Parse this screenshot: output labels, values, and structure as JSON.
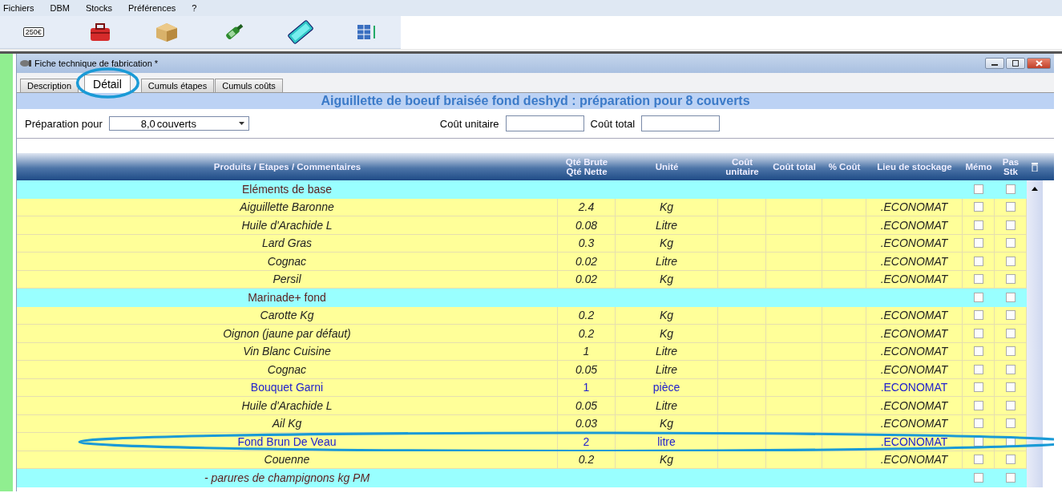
{
  "menu": [
    {
      "label": "Fichiers"
    },
    {
      "label": "DBM"
    },
    {
      "label": "Stocks"
    },
    {
      "label": "Préférences"
    },
    {
      "label": "?"
    }
  ],
  "toolbar": [
    {
      "kind": "tag",
      "label": "250€"
    },
    {
      "kind": "toolbox"
    },
    {
      "kind": "parcel"
    },
    {
      "kind": "bottle"
    },
    {
      "kind": "keyboard"
    },
    {
      "kind": "grid"
    }
  ],
  "window": {
    "title": "Fiche technique de fabrication *"
  },
  "tabs": [
    {
      "label": "Description",
      "selected": false
    },
    {
      "label": "Détail",
      "selected": true,
      "circled": true
    },
    {
      "label": "Cumuls étapes",
      "selected": false
    },
    {
      "label": "Cumuls coûts",
      "selected": false
    }
  ],
  "heading": "Aiguillette de boeuf braisée fond deshyd : préparation pour 8 couverts",
  "preparation": {
    "label": "Préparation pour",
    "value": "8,0",
    "unit": "couverts"
  },
  "unit_cost": {
    "label": "Coût unitaire"
  },
  "total_cost": {
    "label": "Coût total"
  },
  "table": {
    "columns": [
      "Produits / Etapes / Commentaires",
      "Qté Brute\nQté Nette",
      "Unité",
      "Coût\nunitaire",
      "Coût total",
      "% Coût",
      "Lieu de stockage",
      "Mémo",
      "Pas\nStk"
    ],
    "rows": [
      {
        "kind": "step",
        "name": "Eléments de base",
        "memo": false,
        "no_stock": false
      },
      {
        "kind": "product",
        "name": "Aiguillette Baronne",
        "qty": "2.4",
        "unit": "Kg",
        "place": ".ECONOMAT",
        "memo": false,
        "no_stock": false
      },
      {
        "kind": "product",
        "name": "Huile d'Arachide L",
        "qty": "0.08",
        "unit": "Litre",
        "place": ".ECONOMAT",
        "memo": false,
        "no_stock": false
      },
      {
        "kind": "product",
        "name": "Lard Gras",
        "qty": "0.3",
        "unit": "Kg",
        "place": ".ECONOMAT",
        "memo": false,
        "no_stock": false
      },
      {
        "kind": "product",
        "name": "Cognac",
        "qty": "0.02",
        "unit": "Litre",
        "place": ".ECONOMAT",
        "memo": false,
        "no_stock": false
      },
      {
        "kind": "product",
        "name": "Persil",
        "qty": "0.02",
        "unit": "Kg",
        "place": ".ECONOMAT",
        "memo": false,
        "no_stock": false
      },
      {
        "kind": "step",
        "name": "Marinade+ fond",
        "memo": false,
        "no_stock": false
      },
      {
        "kind": "product",
        "name": "Carotte Kg",
        "qty": "0.2",
        "unit": "Kg",
        "place": ".ECONOMAT",
        "memo": false,
        "no_stock": false
      },
      {
        "kind": "product",
        "name": "Oignon (jaune par défaut)",
        "qty": "0.2",
        "unit": "Kg",
        "place": ".ECONOMAT",
        "memo": false,
        "no_stock": false
      },
      {
        "kind": "product",
        "name": "Vin Blanc Cuisine",
        "qty": "1",
        "unit": "Litre",
        "place": ".ECONOMAT",
        "memo": false,
        "no_stock": false
      },
      {
        "kind": "product",
        "name": "Cognac",
        "qty": "0.05",
        "unit": "Litre",
        "place": ".ECONOMAT",
        "memo": false,
        "no_stock": false
      },
      {
        "kind": "recipe",
        "name": "Bouquet Garni",
        "qty": "1",
        "unit": "pièce",
        "place": ".ECONOMAT",
        "memo": false,
        "no_stock": false
      },
      {
        "kind": "product",
        "name": "Huile d'Arachide L",
        "qty": "0.05",
        "unit": "Litre",
        "place": ".ECONOMAT",
        "memo": false,
        "no_stock": false
      },
      {
        "kind": "product",
        "name": "Ail Kg",
        "qty": "0.03",
        "unit": "Kg",
        "place": ".ECONOMAT",
        "memo": false,
        "no_stock": false
      },
      {
        "kind": "recipe",
        "name": "Fond Brun De Veau",
        "qty": "2",
        "unit": "litre",
        "place": ".ECONOMAT",
        "memo": false,
        "no_stock": false,
        "circled": true
      },
      {
        "kind": "product",
        "name": "Couenne",
        "qty": "0.2",
        "unit": "Kg",
        "place": ".ECONOMAT",
        "memo": false,
        "no_stock": false
      },
      {
        "kind": "comment",
        "name": "- parures de champignons kg PM",
        "memo": false,
        "no_stock": false
      }
    ]
  }
}
